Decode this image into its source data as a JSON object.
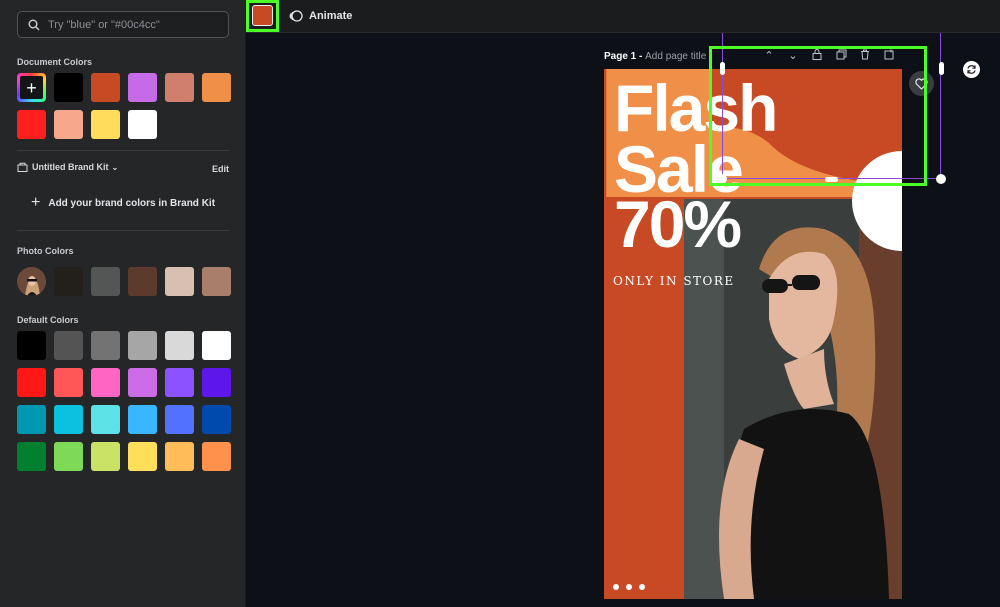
{
  "search": {
    "placeholder": "Try \"blue\" or \"#00c4cc\""
  },
  "sidebar": {
    "document_colors_title": "Document Colors",
    "document_colors": [
      "#000000",
      "#c84a24",
      "#c76ae8",
      "#cf7f6c",
      "#f08f48",
      "#ff1f1f",
      "#f6a78c",
      "#ffdc5c",
      "#ffffff"
    ],
    "brand_kit": {
      "name": "Untitled Brand Kit",
      "edit_label": "Edit",
      "add_label": "Add your brand colors in Brand Kit"
    },
    "photo_colors_title": "Photo Colors",
    "photo_colors": [
      "#231f1b",
      "#545656",
      "#5c3a2c",
      "#d9bfb2",
      "#a77f6a"
    ],
    "default_colors_title": "Default Colors",
    "default_colors": [
      "#000000",
      "#545454",
      "#737373",
      "#a6a6a6",
      "#d9d9d9",
      "#ffffff",
      "#ff1616",
      "#ff5757",
      "#ff66c4",
      "#cb6ce6",
      "#8c52ff",
      "#5e17eb",
      "#0097b2",
      "#0cc0df",
      "#5ce1e6",
      "#38b6ff",
      "#5271ff",
      "#004aad",
      "#00802f",
      "#7ed957",
      "#c9e265",
      "#ffde59",
      "#ffbd59",
      "#ff914d"
    ]
  },
  "toolbar": {
    "selected_color": "#c84a24",
    "animate_label": "Animate"
  },
  "page": {
    "label": "Page 1 -",
    "title_placeholder": "Add page title"
  },
  "design": {
    "headline_1": "Flash",
    "headline_2": "Sale",
    "headline_3": "70%",
    "tagline": "ONLY IN STORE",
    "background_color": "#c84a24",
    "accent_color": "#f08f48"
  },
  "icons": {
    "search": "search-icon",
    "animate": "animate-icon",
    "brand_kit": "brand-kit-icon",
    "add": "plus-icon",
    "refresh": "refresh-icon",
    "heart": "heart-icon"
  }
}
